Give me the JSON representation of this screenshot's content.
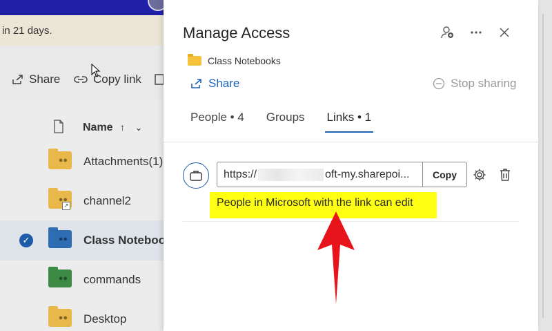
{
  "background": {
    "banner_text": "in 21 days.",
    "commands": {
      "share": "Share",
      "copy_link": "Copy link"
    },
    "list_header": {
      "name": "Name",
      "sort": "↑",
      "chevron": "⌄"
    },
    "rows": [
      {
        "label": "Attachments(1)",
        "folder_color": "#e8b84a"
      },
      {
        "label": "channel2",
        "folder_color": "#e8b84a"
      },
      {
        "label": "Class Notebook",
        "folder_color": "#2f6db3"
      },
      {
        "label": "commands",
        "folder_color": "#3c8a45"
      },
      {
        "label": "Desktop",
        "folder_color": "#e8b84a"
      }
    ]
  },
  "dialog": {
    "title": "Manage Access",
    "header_icons": [
      "add-people-icon",
      "more-icon",
      "close-icon"
    ],
    "item_name": "Class Notebooks",
    "share_label": "Share",
    "stop_sharing_label": "Stop sharing",
    "tabs": [
      {
        "label": "People • 4",
        "active": false
      },
      {
        "label": "Groups",
        "active": false
      },
      {
        "label": "Links • 1",
        "active": true
      }
    ],
    "link": {
      "url_prefix": "https://",
      "url_suffix": "oft-my.sharepoi...",
      "copy_label": "Copy",
      "description": "People in Microsoft with the link can edit"
    }
  },
  "colors": {
    "accent": "#1e63b8",
    "highlight": "#ffff14",
    "arrow": "#e8141c"
  }
}
